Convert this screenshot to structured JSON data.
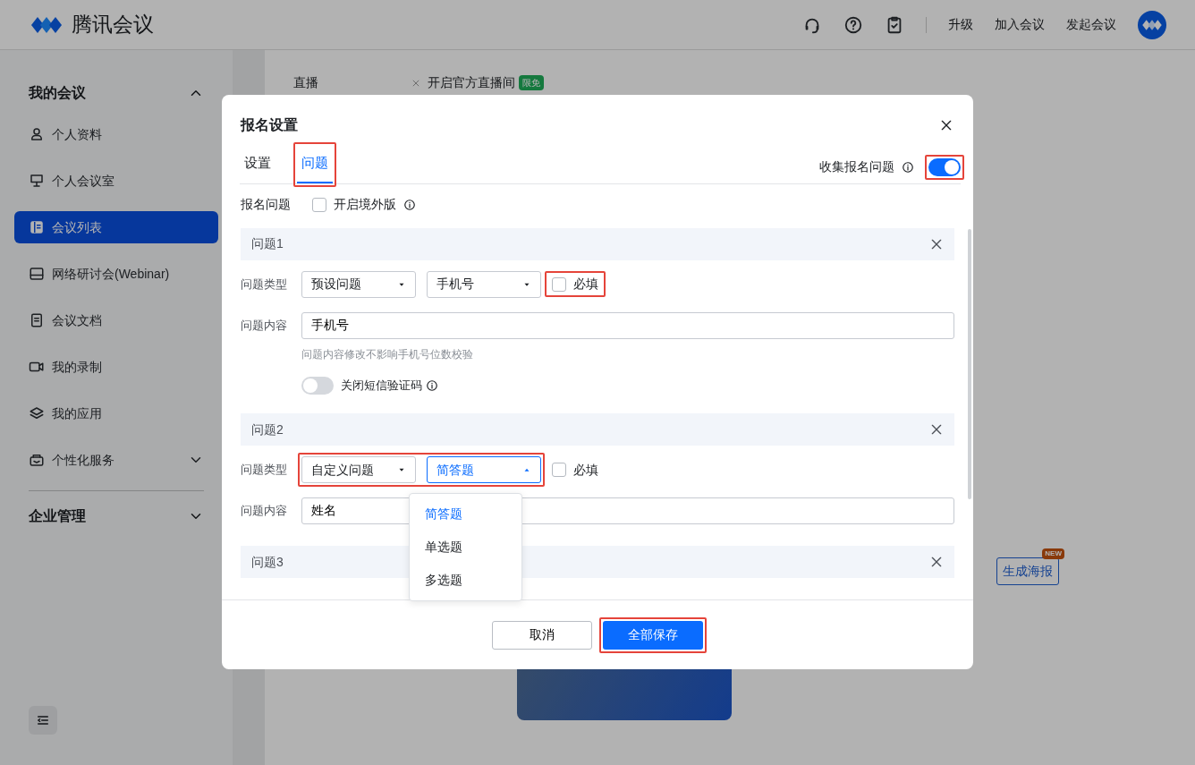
{
  "app": {
    "logo_text": "腾讯会议"
  },
  "header_actions": [
    {
      "label": "升级"
    },
    {
      "label": "加入会议"
    },
    {
      "label": "发起会议"
    }
  ],
  "sidebar": {
    "sections": [
      {
        "title": "我的会议",
        "expanded": true,
        "items": [
          {
            "label": "个人资料",
            "selected": false,
            "kind": "link"
          },
          {
            "label": "个人会议室",
            "selected": false,
            "kind": "link"
          },
          {
            "label": "会议列表",
            "selected": true,
            "kind": "link"
          },
          {
            "label": "网络研讨会(Webinar)",
            "selected": false,
            "kind": "link"
          },
          {
            "label": "会议文档",
            "selected": false,
            "kind": "link"
          },
          {
            "label": "我的录制",
            "selected": false,
            "kind": "link"
          },
          {
            "label": "我的应用",
            "selected": false,
            "kind": "link"
          },
          {
            "label": "个性化服务",
            "selected": false,
            "kind": "group",
            "expanded": false
          }
        ]
      },
      {
        "title": "企业管理",
        "expanded": false
      }
    ]
  },
  "background": {
    "live_label": "直播",
    "live_option": "开启官方直播间",
    "live_badge": "限免",
    "poster_button": "生成海报",
    "poster_badge": "NEW"
  },
  "dialog": {
    "title": "报名设置",
    "tabs": [
      {
        "label": "设置",
        "selected": false,
        "highlighted": false
      },
      {
        "label": "问题",
        "selected": true,
        "highlighted": true
      }
    ],
    "collect": {
      "label": "收集报名问题",
      "on": true,
      "highlighted": true
    },
    "overseas": {
      "label": "报名问题",
      "checkbox_label": "开启境外版",
      "checked": false
    },
    "questions": [
      {
        "title": "问题1",
        "type_label": "问题类型",
        "type": "预设问题",
        "subtype": "手机号",
        "open": false,
        "type_highlighted": false,
        "required_label": "必填",
        "required": false,
        "required_highlighted": true,
        "content_label": "问题内容",
        "content": "手机号",
        "hint": "问题内容修改不影响手机号位数校验",
        "sms": {
          "label": "关闭短信验证码",
          "on": false
        }
      },
      {
        "title": "问题2",
        "type_label": "问题类型",
        "type": "自定义问题",
        "subtype": "简答题",
        "open": true,
        "type_highlighted": true,
        "required_label": "必填",
        "required": false,
        "required_highlighted": false,
        "content_label": "问题内容",
        "content": "姓名"
      },
      {
        "title": "问题3"
      }
    ],
    "dropdown": {
      "options": [
        {
          "label": "简答题",
          "selected": true
        },
        {
          "label": "单选题",
          "selected": false
        },
        {
          "label": "多选题",
          "selected": false
        }
      ]
    },
    "buttons": {
      "cancel": "取消",
      "save": "全部保存",
      "save_highlighted": true
    }
  }
}
